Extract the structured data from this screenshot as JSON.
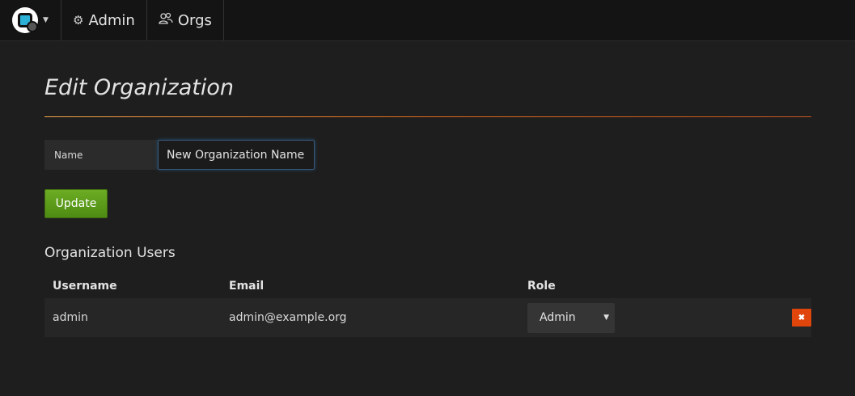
{
  "topnav": {
    "logo_icon": "grafana-logo-icon",
    "items": [
      {
        "label": "Admin",
        "icon": "cogs-icon"
      },
      {
        "label": "Orgs",
        "icon": "users-icon"
      }
    ]
  },
  "page": {
    "title": "Edit Organization",
    "name_label": "Name",
    "name_value": "New Organization Name",
    "update_label": "Update"
  },
  "users": {
    "section_title": "Organization Users",
    "columns": [
      "Username",
      "Email",
      "Role"
    ],
    "rows": [
      {
        "username": "admin",
        "email": "admin@example.org",
        "role": "Admin"
      }
    ]
  },
  "colors": {
    "background": "#1f1e1e",
    "topbar": "#141414",
    "accent_rule": "#e06a1b",
    "update_button": "#5a9a18",
    "remove_button": "#e0460c"
  }
}
